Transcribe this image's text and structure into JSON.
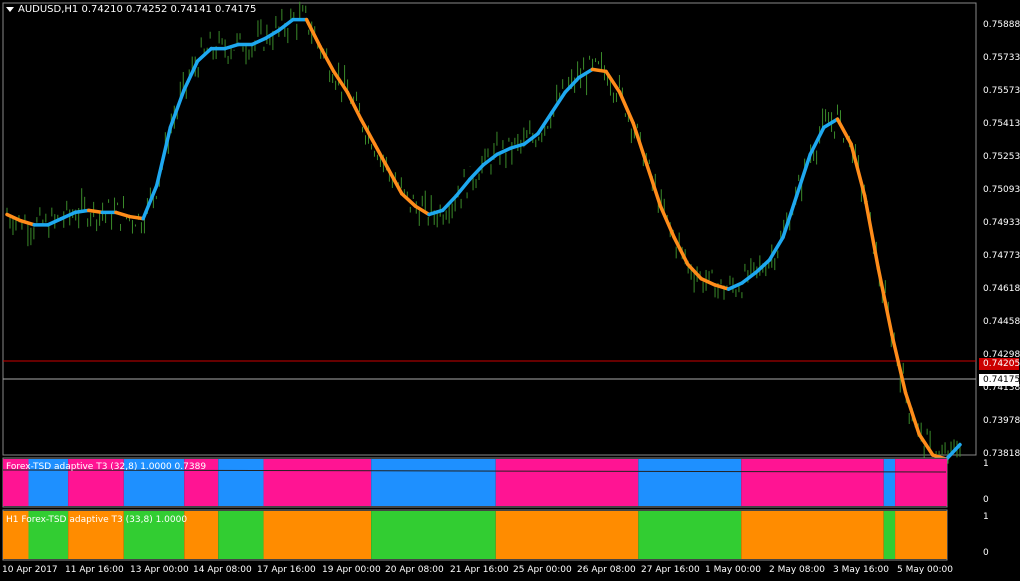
{
  "header": {
    "symbol_line": "AUDUSD,H1  0.74210 0.74252 0.74141 0.74175"
  },
  "colors": {
    "background": "#000000",
    "bars": "#3a8a2a",
    "t3_up": "#1ea8f0",
    "t3_down": "#ff8c1a",
    "tsd_up": "#1e90ff",
    "tsd_down": "#ff1493",
    "h1_up": "#32cd32",
    "h1_down": "#ff8c00",
    "ask_line": "#cc0000",
    "bid_line": "#aaaaaa",
    "frame": "#888888"
  },
  "price_axis": {
    "ticks": [
      "0.75888",
      "0.75733",
      "0.75573",
      "0.75413",
      "0.75253",
      "0.75093",
      "0.74933",
      "0.74773",
      "0.74618",
      "0.74458",
      "0.74298",
      "0.74138",
      "0.73978",
      "0.73818"
    ],
    "ask_tag": "0.74205",
    "bid_tag": "0.74175"
  },
  "time_axis": {
    "labels": [
      "10 Apr 2017",
      "11 Apr 16:00",
      "13 Apr 00:00",
      "14 Apr 08:00",
      "17 Apr 16:00",
      "19 Apr 00:00",
      "20 Apr 08:00",
      "21 Apr 16:00",
      "25 Apr 00:00",
      "26 Apr 08:00",
      "27 Apr 16:00",
      "1 May 00:00",
      "2 May 08:00",
      "3 May 16:00",
      "5 May 00:00"
    ]
  },
  "indicator1": {
    "title": "Forex-TSD adaptive T3 (32,8) 1.0000 0.7389",
    "scale": [
      "1",
      "0"
    ],
    "segments": [
      "down",
      "up",
      "down",
      "up",
      "down",
      "up",
      "down",
      "up",
      "down",
      "up",
      "down",
      "up",
      "down",
      "up"
    ],
    "boundaries": [
      0.0,
      0.027,
      0.069,
      0.128,
      0.192,
      0.228,
      0.276,
      0.39,
      0.522,
      0.673,
      0.782,
      0.933,
      0.945
    ]
  },
  "indicator2": {
    "title": "H1 Forex-TSD adaptive T3 (33,8) 1.0000",
    "scale": [
      "1",
      "0"
    ],
    "segments": [
      "down",
      "up",
      "down",
      "up",
      "down",
      "up",
      "down",
      "up",
      "down",
      "up",
      "down",
      "up",
      "down"
    ],
    "boundaries": [
      0.0,
      0.027,
      0.069,
      0.128,
      0.192,
      0.228,
      0.276,
      0.39,
      0.522,
      0.673,
      0.782,
      0.933,
      0.945
    ]
  },
  "chart_data": {
    "type": "line",
    "title": "AUDUSD,H1  0.74210 0.74252 0.74141 0.74175",
    "ylim": [
      0.738,
      0.7598
    ],
    "x": [
      0,
      1,
      2,
      3,
      4,
      5,
      6,
      7,
      8,
      9,
      10,
      11,
      12,
      13,
      14,
      15,
      16,
      17,
      18,
      19,
      20,
      21,
      22,
      23,
      24,
      25,
      26,
      27,
      28,
      29,
      30,
      31,
      32,
      33,
      34,
      35,
      36,
      37,
      38,
      39,
      40,
      41,
      42,
      43,
      44,
      45,
      46,
      47,
      48,
      49,
      50,
      51,
      52,
      53,
      54,
      55,
      56,
      57,
      58,
      59,
      60,
      61,
      62,
      63,
      64,
      65,
      66,
      67,
      68,
      69,
      70
    ],
    "series": [
      {
        "values": [
          0.7496,
          0.7493,
          0.7491,
          0.7491,
          0.7494,
          0.7497,
          0.7498,
          0.7497,
          0.7497,
          0.7495,
          0.7494,
          0.751,
          0.7538,
          0.7556,
          0.757,
          0.7576,
          0.7576,
          0.7578,
          0.7578,
          0.7581,
          0.7585,
          0.759,
          0.759,
          0.7577,
          0.7565,
          0.7555,
          0.7542,
          0.753,
          0.7518,
          0.7506,
          0.75,
          0.7496,
          0.7498,
          0.7505,
          0.7513,
          0.752,
          0.7525,
          0.7528,
          0.753,
          0.7535,
          0.7545,
          0.7555,
          0.7562,
          0.7566,
          0.7565,
          0.7555,
          0.754,
          0.752,
          0.75,
          0.7485,
          0.7472,
          0.7465,
          0.7462,
          0.746,
          0.7463,
          0.7468,
          0.7474,
          0.7485,
          0.7505,
          0.7525,
          0.7538,
          0.7542,
          0.753,
          0.7505,
          0.747,
          0.7438,
          0.741,
          0.739,
          0.738,
          0.7378,
          0.7385
        ]
      }
    ],
    "bars_note": ""
  }
}
